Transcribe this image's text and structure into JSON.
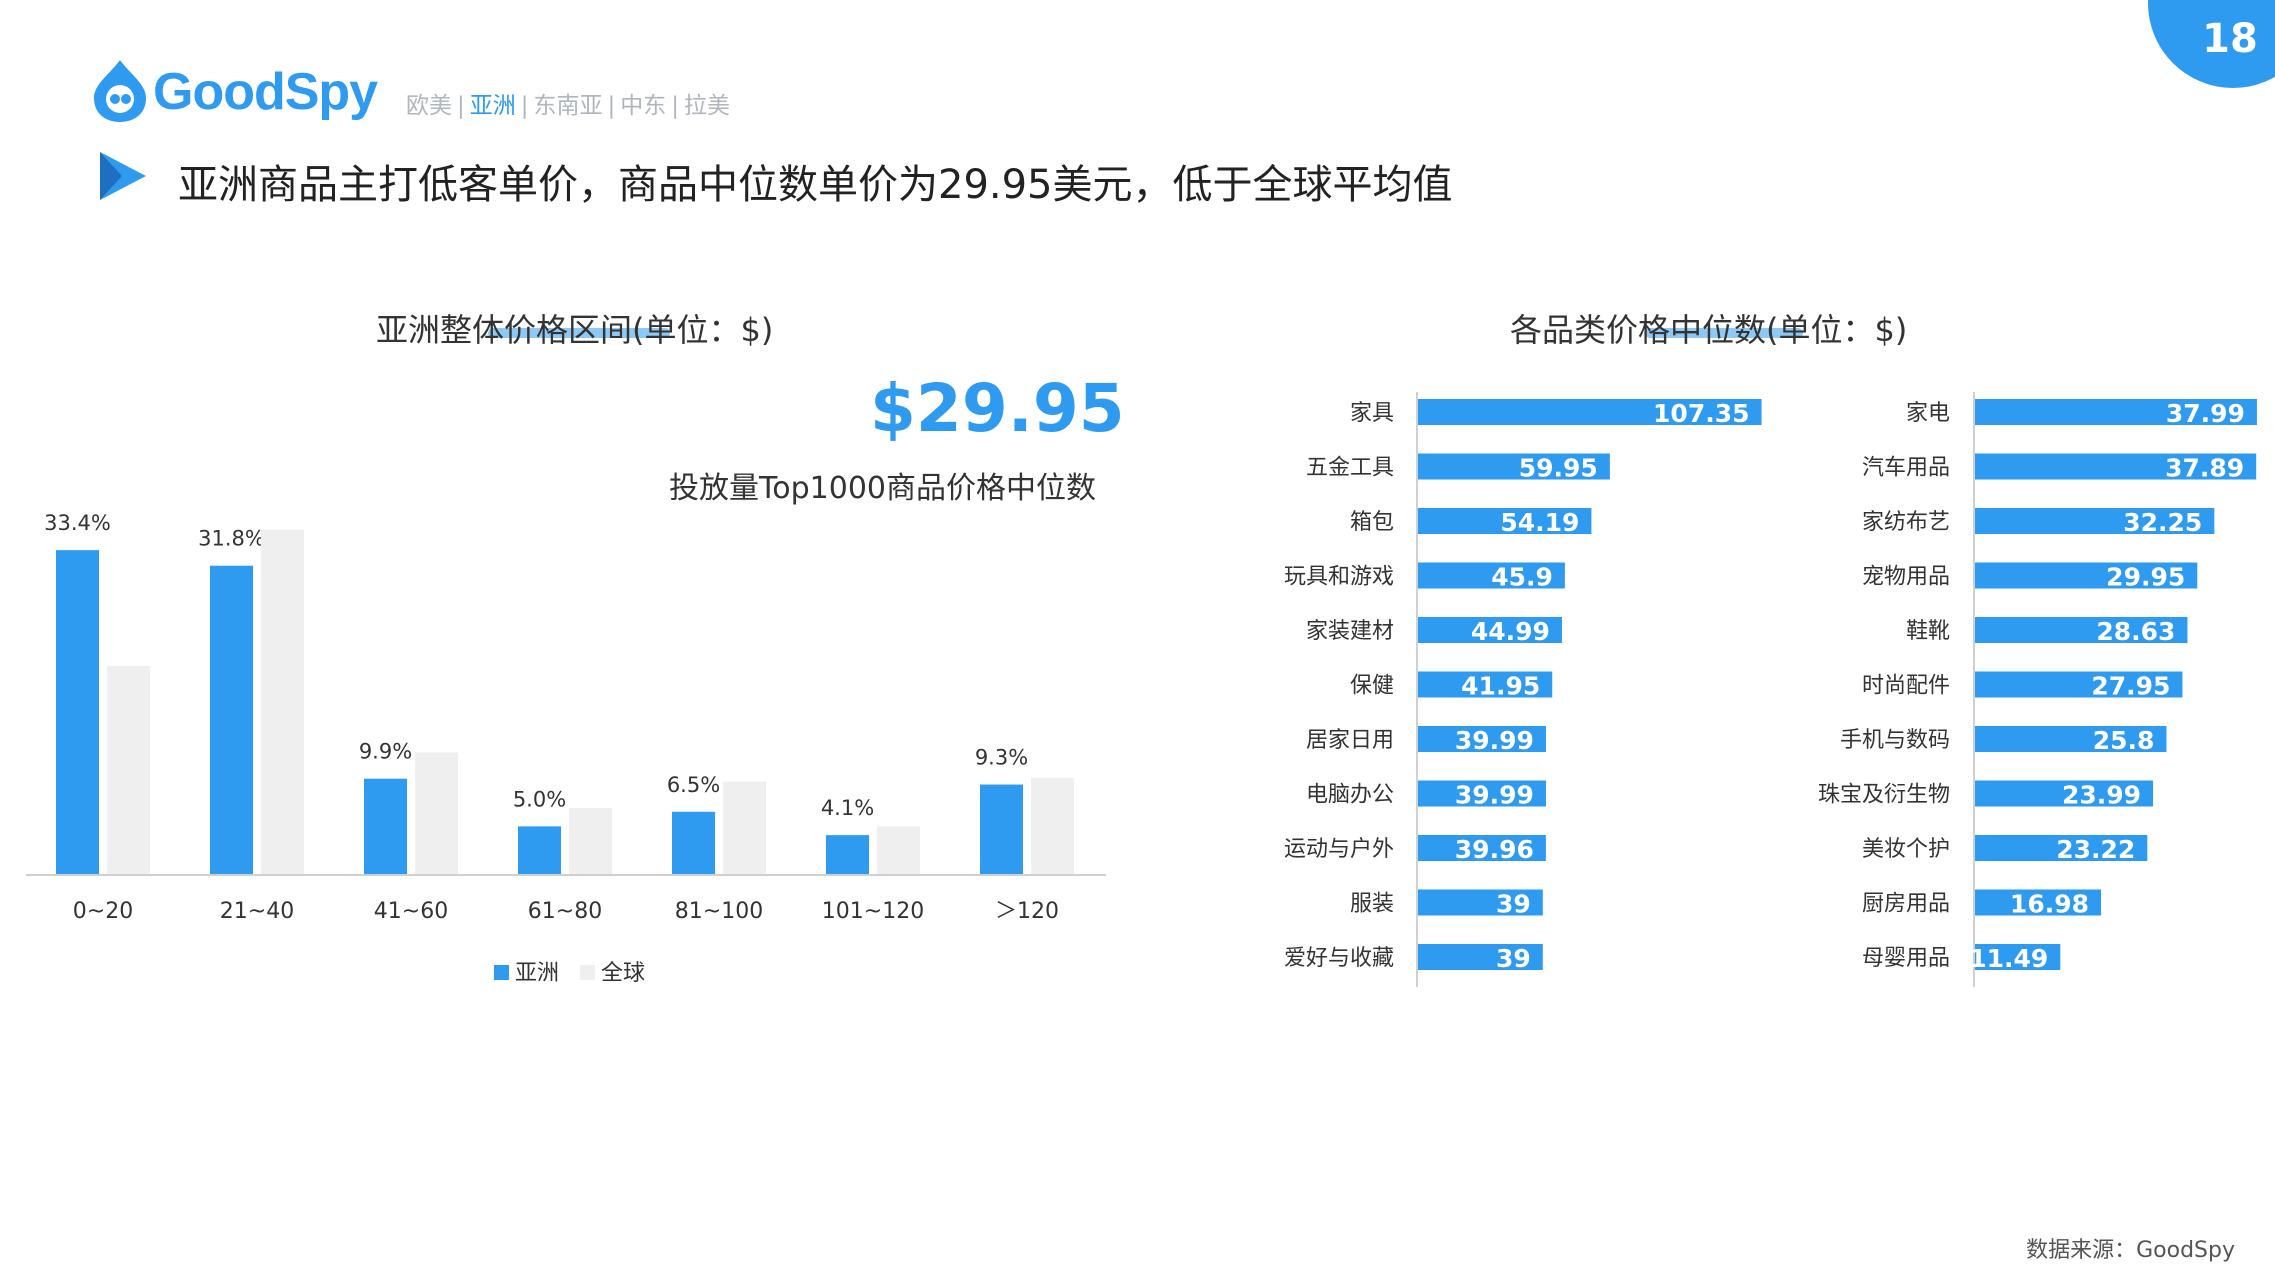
{
  "page_number": "18",
  "brand": {
    "name": "GoodSpy"
  },
  "region_nav": {
    "items": [
      {
        "label": "欧美",
        "active": false
      },
      {
        "label": "亚洲",
        "active": true
      },
      {
        "label": "东南亚",
        "active": false
      },
      {
        "label": "中东",
        "active": false
      },
      {
        "label": "拉美",
        "active": false
      }
    ],
    "separator": "|"
  },
  "headline": "亚洲商品主打低客单价，商品中位数单价为29.95美元，低于全球平均值",
  "median": {
    "value": "$29.95",
    "caption": "投放量Top1000商品价格中位数"
  },
  "footer": {
    "source": "数据来源：GoodSpy"
  },
  "colors": {
    "accent": "#2e9bf0",
    "global_bar": "#efefef"
  },
  "chart_data": [
    {
      "type": "bar",
      "title": "亚洲整体价格区间(单位：$)",
      "categories": [
        "0~20",
        "21~40",
        "41~60",
        "61~80",
        "81~100",
        "101~120",
        "＞120"
      ],
      "series": [
        {
          "name": "亚洲",
          "values": [
            33.4,
            31.8,
            9.9,
            5.0,
            6.5,
            4.1,
            9.3
          ],
          "labels": [
            "33.4%",
            "31.8%",
            "9.9%",
            "5.0%",
            "6.5%",
            "4.1%",
            "9.3%"
          ]
        },
        {
          "name": "全球",
          "values": [
            21.5,
            35.5,
            12.6,
            6.9,
            9.6,
            5.0,
            10.0
          ]
        }
      ],
      "ylim": [
        0,
        36.5
      ],
      "legend": "bottom",
      "grid": false
    },
    {
      "type": "bar",
      "orientation": "horizontal",
      "title": "各品类价格中位数(单位：$)",
      "groups": [
        {
          "categories": [
            "家具",
            "五金工具",
            "箱包",
            "玩具和游戏",
            "家装建材",
            "保健",
            "居家日用",
            "电脑办公",
            "运动与户外",
            "服装",
            "爱好与收藏"
          ],
          "values": [
            107.35,
            59.95,
            54.19,
            45.9,
            44.99,
            41.95,
            39.99,
            39.99,
            39.96,
            39,
            39
          ],
          "labels": [
            "107.35",
            "59.95",
            "54.19",
            "45.9",
            "44.99",
            "41.95",
            "39.99",
            "39.99",
            "39.96",
            "39",
            "39"
          ]
        },
        {
          "categories": [
            "家电",
            "汽车用品",
            "家纺布艺",
            "宠物用品",
            "鞋靴",
            "时尚配件",
            "手机与数码",
            "珠宝及衍生物",
            "美妆个护",
            "厨房用品",
            "母婴用品"
          ],
          "values": [
            37.99,
            37.89,
            32.25,
            29.95,
            28.63,
            27.95,
            25.8,
            23.99,
            23.22,
            16.98,
            11.49
          ],
          "labels": [
            "37.99",
            "37.89",
            "32.25",
            "29.95",
            "28.63",
            "27.95",
            "25.8",
            "23.99",
            "23.22",
            "16.98",
            "11.49"
          ]
        }
      ]
    }
  ]
}
